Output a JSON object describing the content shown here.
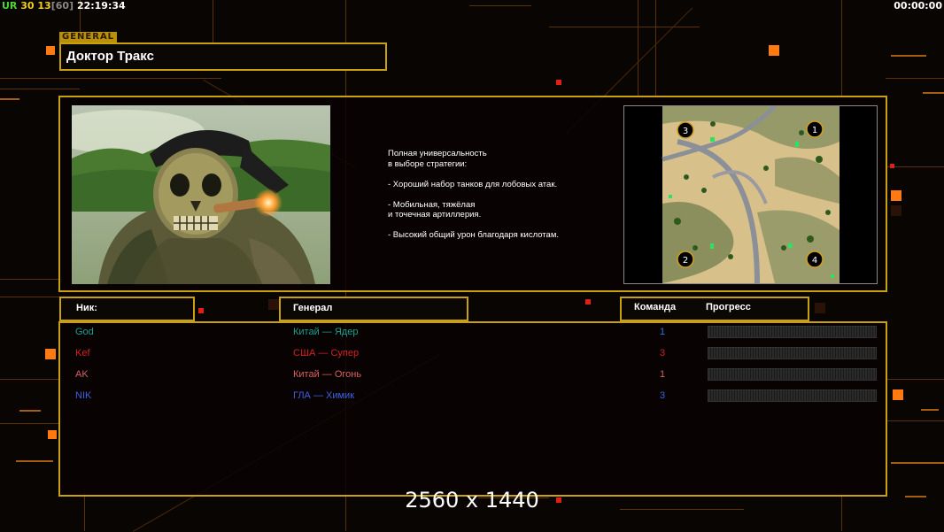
{
  "hud": {
    "ur_label": "UR",
    "value_a": "30",
    "value_b": "13",
    "value_c": "[60]",
    "clock": "22:19:34",
    "timer": "00:00:00"
  },
  "general_tag": "GENERAL",
  "general_name": "Доктор Тракс",
  "description": "Полная универсальность\nв выборе стратегии:\n\n- Хороший набор танков для лобовых атак.\n\n- Мобильная, тяжёлая\nи точечная артиллерия.\n\n- Высокий общий урон благодаря кислотам.",
  "headers": {
    "nick": "Ник:",
    "general": "Генерал",
    "team": "Команда",
    "progress": "Прогресс"
  },
  "players": [
    {
      "nick": "God",
      "general": "Китай — Ядер",
      "team": "1",
      "color": "#1e9e8e",
      "team_color": "#2a7ad8",
      "progress": 0
    },
    {
      "nick": "Kef",
      "general": "США — Супер",
      "team": "3",
      "color": "#d82020",
      "team_color": "#d82020",
      "progress": 0
    },
    {
      "nick": "AK",
      "general": "Китай — Огонь",
      "team": "1",
      "color": "#d86060",
      "team_color": "#d86060",
      "progress": 0
    },
    {
      "nick": "NIK",
      "general": "ГЛА — Химик",
      "team": "3",
      "color": "#4060e0",
      "team_color": "#4060e0",
      "progress": 0
    }
  ],
  "minimap_slots": [
    "3",
    "1",
    "2",
    "4"
  ],
  "resolution_label": "2560 x 1440",
  "colors": {
    "accent": "#c9a010",
    "background": "#090503",
    "decor": "#ff7a10"
  }
}
